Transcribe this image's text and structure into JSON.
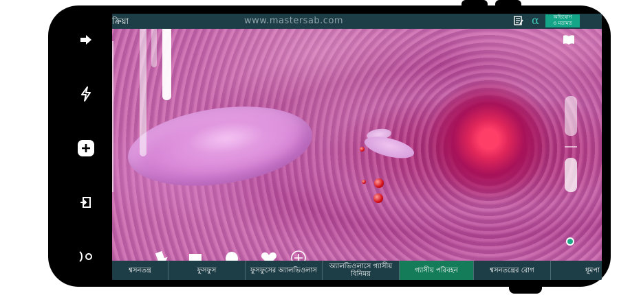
{
  "topbar": {
    "title": "ক্রিয়া",
    "watermark": "www.mastersab.com",
    "alpha_glyph": "α",
    "dictionary_label_line1": "অভিযোগ",
    "dictionary_label_line2": "ও মতামত"
  },
  "left_rail": {
    "items": [
      {
        "icon": "arrow-right-icon",
        "glyph": "➡"
      },
      {
        "icon": "lightning-icon",
        "glyph": "ϟ"
      },
      {
        "icon": "plus-icon",
        "glyph": "+"
      },
      {
        "icon": "exit-icon",
        "glyph": "⎗"
      },
      {
        "icon": "toggle-icon",
        "glyph": ")○"
      }
    ]
  },
  "tabs": [
    {
      "label": "শ্বসনতন্ত্র",
      "active": false
    },
    {
      "label": "ফুসফুস",
      "active": false
    },
    {
      "label": "ফুসফুসের অ্যালভিওলাস",
      "active": false
    },
    {
      "label": "অ্যালভিওলাসে গ্যাসীয় বিনিময়",
      "active": false
    },
    {
      "label": "গ্যাসীয় পরিবহন",
      "active": true
    },
    {
      "label": "শ্বসনতন্ত্রের রোগ",
      "active": false
    },
    {
      "label": "ধূমপা",
      "active": false
    }
  ],
  "colors": {
    "bar_bg": "#1e3e47",
    "active_tab": "#157c5a",
    "accent": "#3cc6b4"
  }
}
